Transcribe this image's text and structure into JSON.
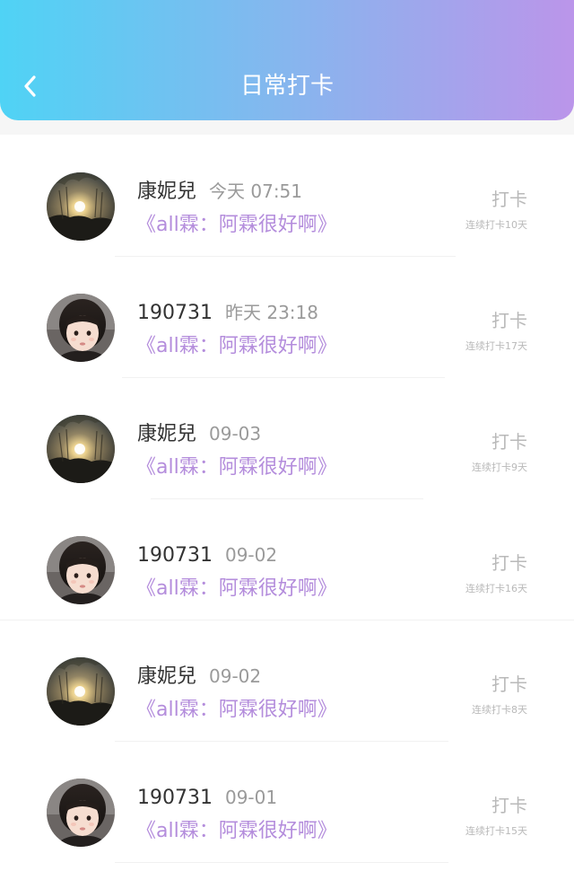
{
  "header": {
    "title": "日常打卡",
    "back_icon": "chevron-left-icon",
    "gradient": [
      "#4fd3f5",
      "#bb95ea"
    ]
  },
  "entries": [
    {
      "name": "康妮兒",
      "time": "今天 07:51",
      "topic": "《all霖：阿霖很好啊》",
      "action": "打卡",
      "streak": "连续打卡10天",
      "avatar": "sunset"
    },
    {
      "name": "190731",
      "time": "昨天 23:18",
      "topic": "《all霖：阿霖很好啊》",
      "action": "打卡",
      "streak": "连续打卡17天",
      "avatar": "child"
    },
    {
      "name": "康妮兒",
      "time": "09-03",
      "topic": "《all霖：阿霖很好啊》",
      "action": "打卡",
      "streak": "连续打卡9天",
      "avatar": "sunset"
    },
    {
      "name": "190731",
      "time": "09-02",
      "topic": "《all霖：阿霖很好啊》",
      "action": "打卡",
      "streak": "连续打卡16天",
      "avatar": "child"
    },
    {
      "name": "康妮兒",
      "time": "09-02",
      "topic": "《all霖：阿霖很好啊》",
      "action": "打卡",
      "streak": "连续打卡8天",
      "avatar": "sunset"
    },
    {
      "name": "190731",
      "time": "09-01",
      "topic": "《all霖：阿霖很好啊》",
      "action": "打卡",
      "streak": "连续打卡15天",
      "avatar": "child"
    }
  ],
  "colors": {
    "topic": "#b48ddc",
    "name": "#333333",
    "muted": "#9a9a9a"
  }
}
